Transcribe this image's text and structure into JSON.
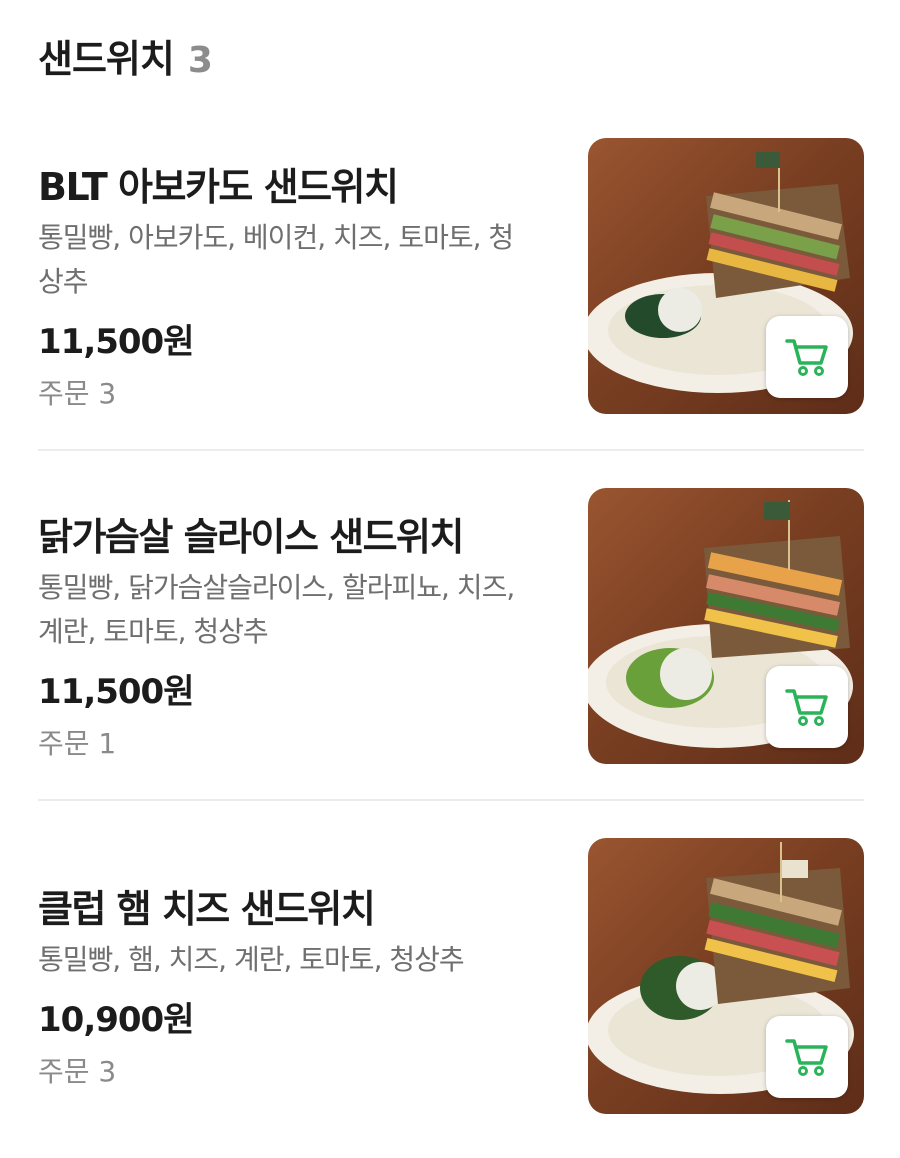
{
  "section": {
    "title": "샌드위치",
    "count": "3"
  },
  "items": [
    {
      "name": "BLT 아보카도 샌드위치",
      "description": "통밀빵, 아보카도, 베이컨, 치즈, 토마토, 청상추",
      "price": "11,500원",
      "orders": "주문 3"
    },
    {
      "name": "닭가슴살 슬라이스 샌드위치",
      "description": "통밀빵, 닭가슴살슬라이스, 할라피뇨, 치즈, 계란, 토마토, 청상추",
      "price": "11,500원",
      "orders": "주문 1"
    },
    {
      "name": "클럽 햄 치즈 샌드위치",
      "description": "통밀빵, 햄, 치즈, 계란, 토마토, 청상추",
      "price": "10,900원",
      "orders": "주문 3"
    }
  ],
  "icons": {
    "cart": "cart-icon",
    "accent": "#2bb35a"
  }
}
